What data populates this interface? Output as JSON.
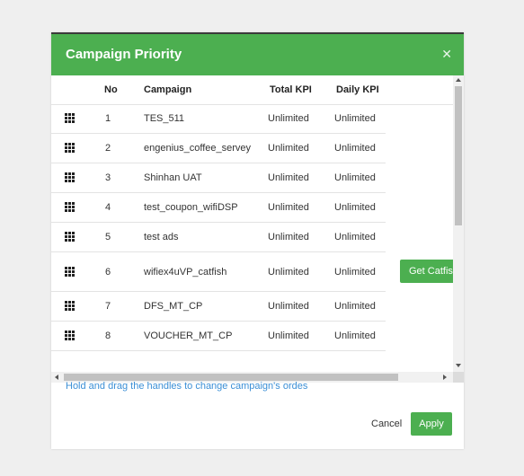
{
  "modal": {
    "title": "Campaign Priority",
    "close_icon": "close-icon",
    "hint": "Hold and drag the handles to change campaign's ordes",
    "cancel_label": "Cancel",
    "apply_label": "Apply"
  },
  "table": {
    "headers": {
      "no": "No",
      "campaign": "Campaign",
      "total_kpi": "Total KPI",
      "daily_kpi": "Daily KPI"
    },
    "rows": [
      {
        "no": "1",
        "campaign": "TES_511",
        "total_kpi": "Unlimited",
        "daily_kpi": "Unlimited"
      },
      {
        "no": "2",
        "campaign": "engenius_coffee_servey",
        "total_kpi": "Unlimited",
        "daily_kpi": "Unlimited"
      },
      {
        "no": "3",
        "campaign": "Shinhan UAT",
        "total_kpi": "Unlimited",
        "daily_kpi": "Unlimited"
      },
      {
        "no": "4",
        "campaign": "test_coupon_wifiDSP",
        "total_kpi": "Unlimited",
        "daily_kpi": "Unlimited"
      },
      {
        "no": "5",
        "campaign": "test ads",
        "total_kpi": "Unlimited",
        "daily_kpi": "Unlimited"
      },
      {
        "no": "6",
        "campaign": "wifiex4uVP_catfish",
        "total_kpi": "Unlimited",
        "daily_kpi": "Unlimited",
        "action": "Get Catfish"
      },
      {
        "no": "7",
        "campaign": "DFS_MT_CP",
        "total_kpi": "Unlimited",
        "daily_kpi": "Unlimited"
      },
      {
        "no": "8",
        "campaign": "VOUCHER_MT_CP",
        "total_kpi": "Unlimited",
        "daily_kpi": "Unlimited"
      }
    ]
  },
  "colors": {
    "accent": "#4caf50",
    "link": "#3b8fd6"
  },
  "icons": {
    "handle": "drag-handle-icon"
  }
}
